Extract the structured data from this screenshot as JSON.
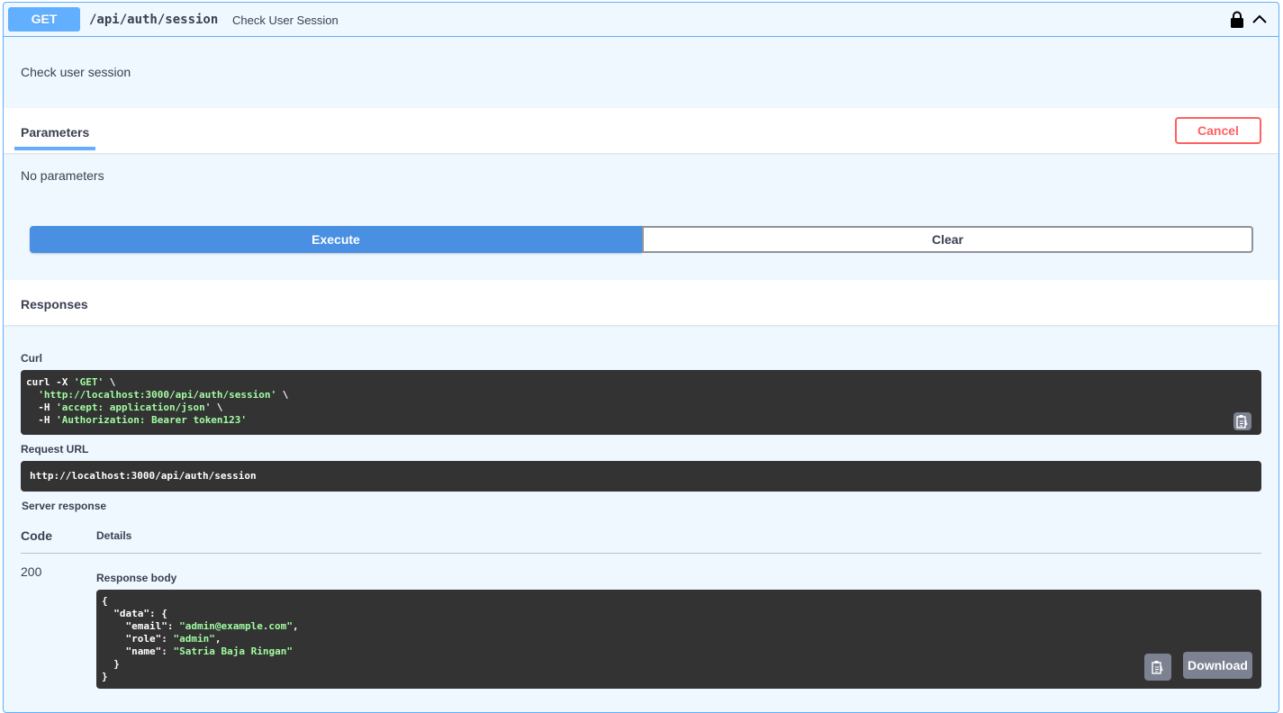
{
  "operation": {
    "method": "GET",
    "path": "/api/auth/session",
    "summary": "Check User Session",
    "description": "Check user session"
  },
  "parameters": {
    "tab_label": "Parameters",
    "cancel_label": "Cancel",
    "empty_text": "No parameters"
  },
  "actions": {
    "execute_label": "Execute",
    "clear_label": "Clear"
  },
  "responses": {
    "title": "Responses",
    "curl_label": "Curl",
    "curl_lines": [
      {
        "pre": "curl -X ",
        "str": "'GET'",
        "post": " \\"
      },
      {
        "pre": "  ",
        "str": "'http://localhost:3000/api/auth/session'",
        "post": " \\"
      },
      {
        "pre": "  -H ",
        "str": "'accept: application/json'",
        "post": " \\"
      },
      {
        "pre": "  -H ",
        "str": "'Authorization: Bearer token123'",
        "post": ""
      }
    ],
    "request_url_label": "Request URL",
    "request_url": "http://localhost:3000/api/auth/session",
    "server_response_label": "Server response",
    "col_code": "Code",
    "col_details": "Details",
    "code": "200",
    "response_body_label": "Response body",
    "response_body": {
      "email": "admin@example.com",
      "role": "admin",
      "name": "Satria Baja Ringan"
    },
    "download_label": "Download"
  },
  "colors": {
    "get_accent": "#61affe",
    "execute": "#4990e2",
    "cancel": "#ff6060",
    "code_bg": "#333333",
    "code_string": "#a2fca2"
  },
  "icons": [
    "lock-icon",
    "chevron-up-icon",
    "copy-icon"
  ]
}
